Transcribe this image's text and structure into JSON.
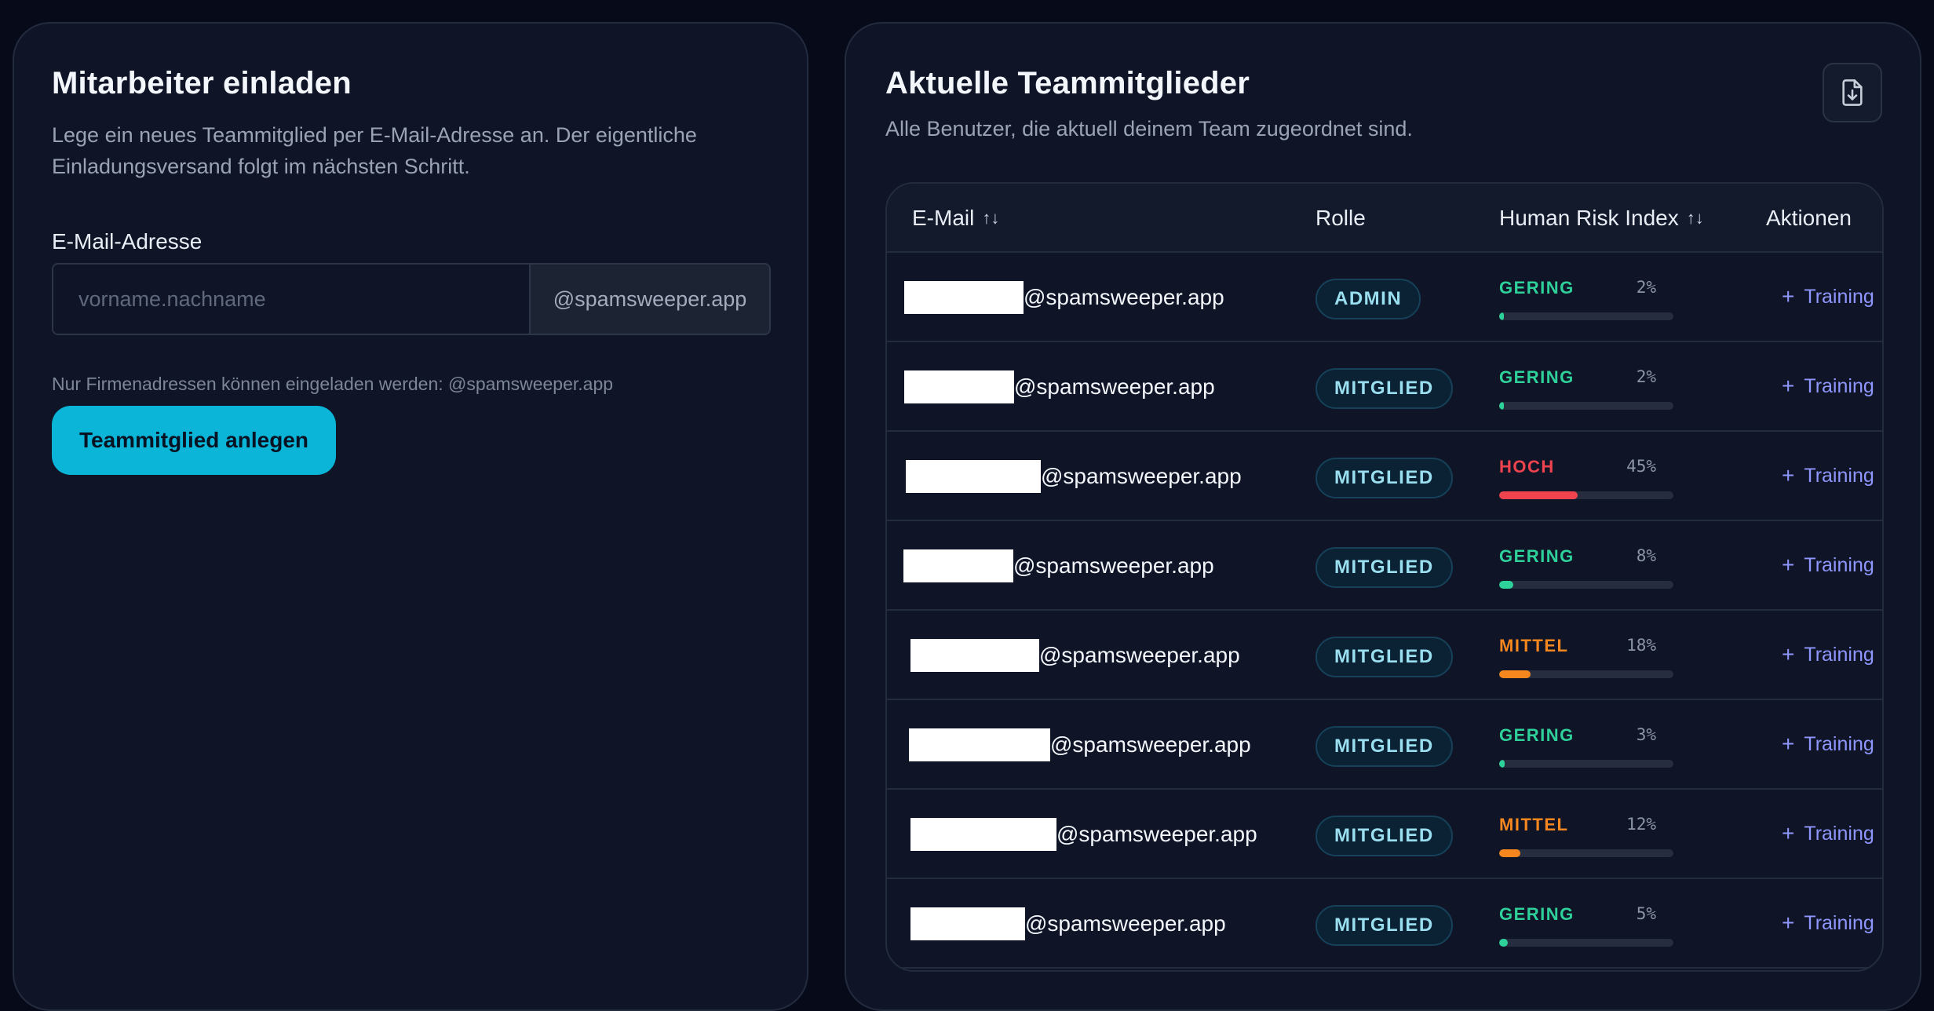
{
  "invite": {
    "title": "Mitarbeiter einladen",
    "description": "Lege ein neues Teammitglied per E-Mail-Adresse an. Der eigentliche Einladungsversand folgt im nächsten Schritt.",
    "email_label": "E-Mail-Adresse",
    "email_placeholder": "vorname.nachname",
    "email_value": "",
    "email_suffix": "@spamsweeper.app",
    "hint": "Nur Firmenadressen können eingeladen werden: @spamsweeper.app",
    "button_label": "Teammitglied anlegen"
  },
  "team": {
    "title": "Aktuelle Teammitglieder",
    "description": "Alle Benutzer, die aktuell deinem Team zugeordnet sind.",
    "export_icon": "file-download-icon",
    "columns": {
      "email": "E-Mail",
      "role": "Rolle",
      "risk": "Human Risk Index",
      "actions": "Aktionen"
    },
    "sort_icon": "↑↓",
    "training_label": "Training",
    "rows": [
      {
        "domain": "@spamsweeper.app",
        "role": "ADMIN",
        "risk_label": "GERING",
        "risk_pct": "2%",
        "risk_value": 2,
        "risk_color": "#2fd19a"
      },
      {
        "domain": "@spamsweeper.app",
        "role": "MITGLIED",
        "risk_label": "GERING",
        "risk_pct": "2%",
        "risk_value": 2,
        "risk_color": "#2fd19a"
      },
      {
        "domain": "@spamsweeper.app",
        "role": "MITGLIED",
        "risk_label": "HOCH",
        "risk_pct": "45%",
        "risk_value": 45,
        "risk_color": "#f0434d"
      },
      {
        "domain": "@spamsweeper.app",
        "role": "MITGLIED",
        "risk_label": "GERING",
        "risk_pct": "8%",
        "risk_value": 8,
        "risk_color": "#2fd19a"
      },
      {
        "domain": "@spamsweeper.app",
        "role": "MITGLIED",
        "risk_label": "MITTEL",
        "risk_pct": "18%",
        "risk_value": 18,
        "risk_color": "#f6871f"
      },
      {
        "domain": "@spamsweeper.app",
        "role": "MITGLIED",
        "risk_label": "GERING",
        "risk_pct": "3%",
        "risk_value": 3,
        "risk_color": "#2fd19a"
      },
      {
        "domain": "@spamsweeper.app",
        "role": "MITGLIED",
        "risk_label": "MITTEL",
        "risk_pct": "12%",
        "risk_value": 12,
        "risk_color": "#f6871f"
      },
      {
        "domain": "@spamsweeper.app",
        "role": "MITGLIED",
        "risk_label": "GERING",
        "risk_pct": "5%",
        "risk_value": 5,
        "risk_color": "#2fd19a"
      }
    ]
  }
}
